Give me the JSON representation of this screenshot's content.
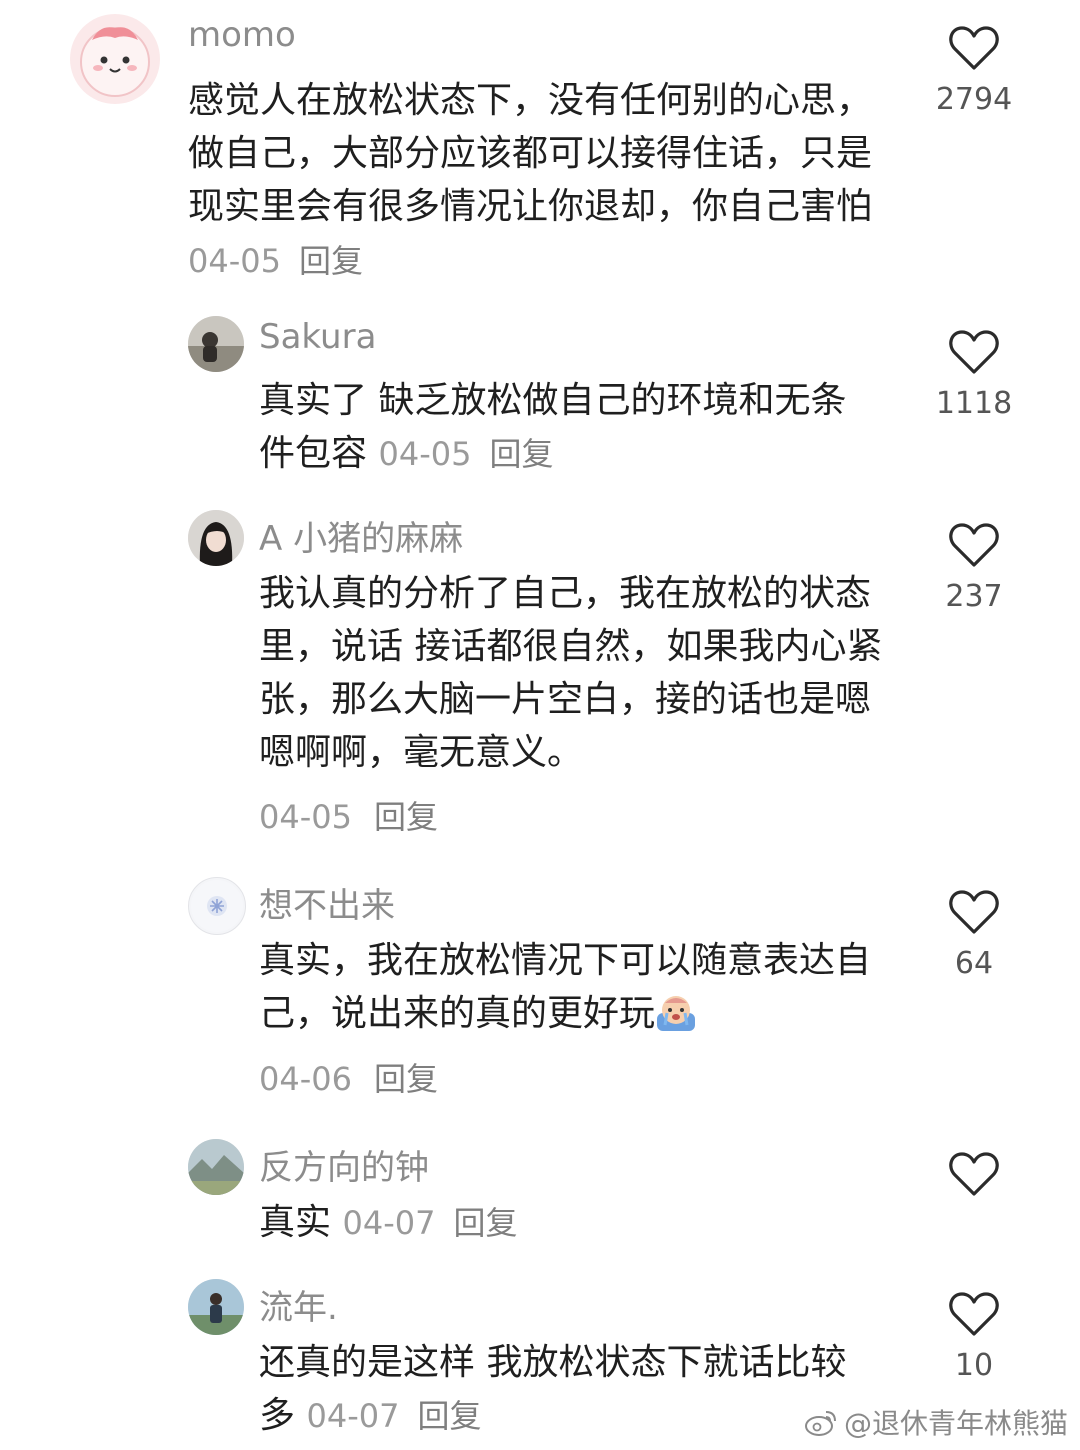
{
  "comments": [
    {
      "username": "momo",
      "text": "感觉人在放松状态下，没有任何别的心思，做自己，大部分应该都可以接得住话，只是现实里会有很多情况让你退却，你自己害怕",
      "date": "04-05",
      "reply_label": "回复",
      "likes": "2794",
      "avatar_icon": "pink-cartoon-avatar-icon"
    },
    {
      "username": "Sakura",
      "text": "真实了 缺乏放松做自己的环境和无条件包容",
      "date": "04-05",
      "reply_label": "回复",
      "likes": "1118",
      "avatar_icon": "photo-avatar-icon"
    },
    {
      "username": "A 小猪的麻麻",
      "text": "我认真的分析了自己，我在放松的状态里，说话 接话都很自然，如果我内心紧张，那么大脑一片空白，接的话也是嗯嗯啊啊，毫无意义。",
      "date": "04-05",
      "reply_label": "回复",
      "likes": "237",
      "avatar_icon": "girl-portrait-avatar-icon"
    },
    {
      "username": "想不出来",
      "text": "真实，我在放松情况下可以随意表达自己，说出来的真的更好玩",
      "date": "04-06",
      "reply_label": "回复",
      "likes": "64",
      "avatar_icon": "snowflake-avatar-icon",
      "emoji": "crying-emoji-icon"
    },
    {
      "username": "反方向的钟",
      "text": "真实",
      "date": "04-07",
      "reply_label": "回复",
      "likes": "",
      "avatar_icon": "landscape-avatar-icon"
    },
    {
      "username": "流年.",
      "text": "还真的是这样 我放松状态下就话比较多",
      "date": "04-07",
      "reply_label": "回复",
      "likes": "10",
      "avatar_icon": "person-outdoor-avatar-icon"
    }
  ],
  "watermark": "@退休青年林熊猫",
  "colors": {
    "text": "#1f1f1f",
    "username": "#8c8c8c",
    "meta": "#9a9a9a",
    "heart_outline": "#2b2b2b"
  }
}
